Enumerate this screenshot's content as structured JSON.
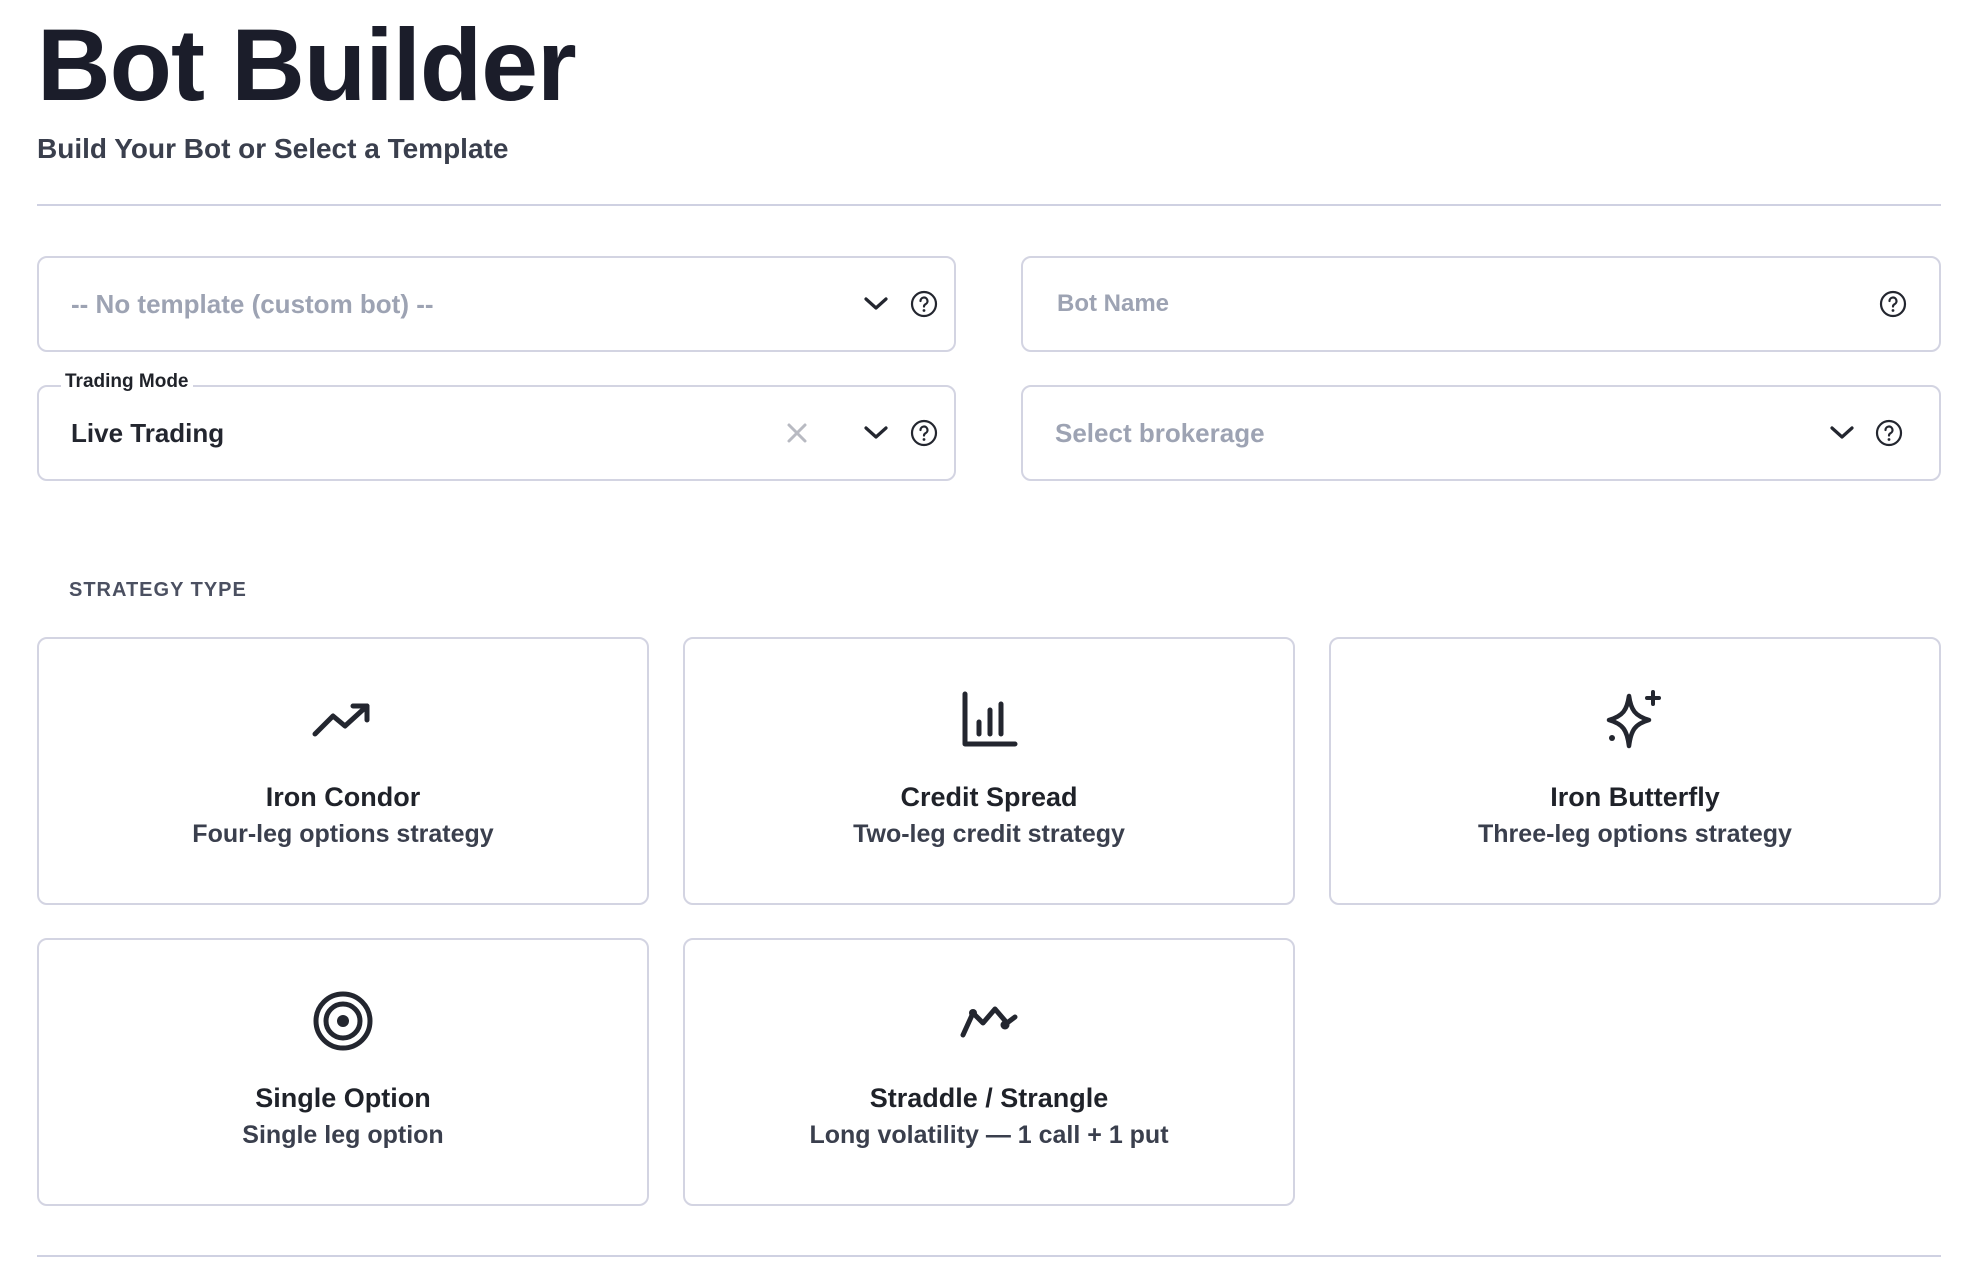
{
  "header": {
    "title": "Bot Builder",
    "subtitle": "Build Your Bot or Select a Template"
  },
  "form": {
    "template_select": {
      "value": "-- No template (custom bot) --",
      "icons": [
        "chevron-down-icon",
        "help-circle-icon"
      ]
    },
    "bot_name": {
      "placeholder": "Bot Name",
      "value": "",
      "icons": [
        "help-circle-icon"
      ]
    },
    "trading_mode": {
      "label": "Trading Mode",
      "value": "Live Trading",
      "icons": [
        "clear-x-icon",
        "chevron-down-icon",
        "help-circle-icon"
      ]
    },
    "brokerage_select": {
      "placeholder": "Select brokerage",
      "icons": [
        "chevron-down-icon",
        "help-circle-icon"
      ]
    }
  },
  "strategy": {
    "section_label": "STRATEGY TYPE",
    "cards": [
      {
        "title": "Iron Condor",
        "description": "Four-leg options strategy",
        "icon": "trending-up-icon"
      },
      {
        "title": "Credit Spread",
        "description": "Two-leg credit strategy",
        "icon": "bar-chart-icon"
      },
      {
        "title": "Iron Butterfly",
        "description": "Three-leg options strategy",
        "icon": "sparkles-icon"
      },
      {
        "title": "Single Option",
        "description": "Single leg option",
        "icon": "target-icon"
      },
      {
        "title": "Straddle / Strangle",
        "description": "Long volatility — 1 call + 1 put",
        "icon": "chart-line-icon"
      }
    ]
  },
  "colors": {
    "text_primary": "#1b1d2a",
    "text_secondary": "#3a3f4d",
    "placeholder": "#9da3b3",
    "border": "#d3d4e2",
    "clear_icon": "#b8bac2"
  }
}
